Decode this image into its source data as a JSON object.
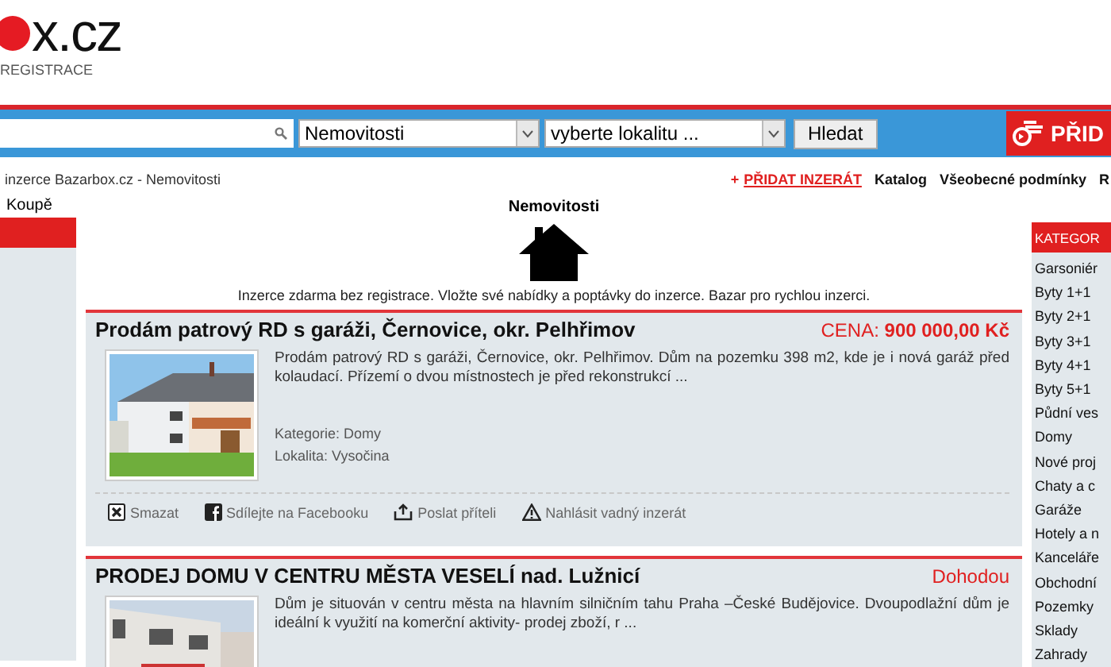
{
  "logo": {
    "after": "x.cz",
    "subtitle": "REGISTRACE"
  },
  "search": {
    "category": "Nemovitosti",
    "locality": "vyberte lokalitu ...",
    "button": "Hledat"
  },
  "add_button": {
    "label": "PŘID"
  },
  "breadcrumb": "inzerce Bazarbox.cz - Nemovitosti",
  "top_links": [
    {
      "label": "PŘIDAT INZERÁT",
      "prefix": "+",
      "kind": "primary"
    },
    {
      "label": "Katalog",
      "kind": "plain"
    },
    {
      "label": "Všeobecné podmínky",
      "kind": "plain"
    },
    {
      "label": "R",
      "kind": "plain"
    }
  ],
  "left_sidebar": {
    "item": "Koupě"
  },
  "section": {
    "title": "Nemovitosti",
    "intro": "Inzerce zdarma bez registrace. Vložte své nabídky a poptávky do inzerce. Bazar pro rychlou inzerci."
  },
  "listings": [
    {
      "title": "Prodám patrový RD s garáži, Černovice, okr. Pelhřimov",
      "price_label": "CENA: ",
      "price": "900 000,00 Kč",
      "kind": "price",
      "description": "Prodám patrový RD s garáži, Černovice, okr. Pelhřimov. Dům na pozemku 398 m2, kde je i nová garáž před kolaudací. Přízemí o dvou místnostech je před rekonstrukcí ...",
      "category": "Kategorie: Domy",
      "locality": "Lokalita: Vysočina",
      "actions": [
        {
          "label": "Smazat",
          "kind": "delete"
        },
        {
          "label": "Sdílejte na Facebooku",
          "kind": "facebook"
        },
        {
          "label": "Poslat příteli",
          "kind": "send"
        },
        {
          "label": "Nahlásit vadný inzerát",
          "kind": "report"
        }
      ]
    },
    {
      "title": "PRODEJ DOMU V CENTRU MĚSTA VESELÍ nad. Lužnicí",
      "price_label": "Dohodou",
      "kind": "negotiable",
      "description": "Dům je situován v centru města na hlavním silničním tahu Praha –České Budějovice. Dvoupodlažní dům je ideální k využití na komerční aktivity- prodej zboží, r ..."
    }
  ],
  "categories": {
    "title": "KATEGOR",
    "items": [
      "Garsoniér",
      "Byty 1+1",
      "Byty 2+1",
      "Byty 3+1",
      "Byty 4+1",
      "Byty 5+1",
      "Půdní ves",
      "Domy",
      "Nové proj",
      "Chaty a c",
      "Garáže",
      "Hotely a n",
      "Kanceláře",
      "Obchodní",
      "Pozemky",
      "Sklady",
      "Zahrady"
    ]
  }
}
